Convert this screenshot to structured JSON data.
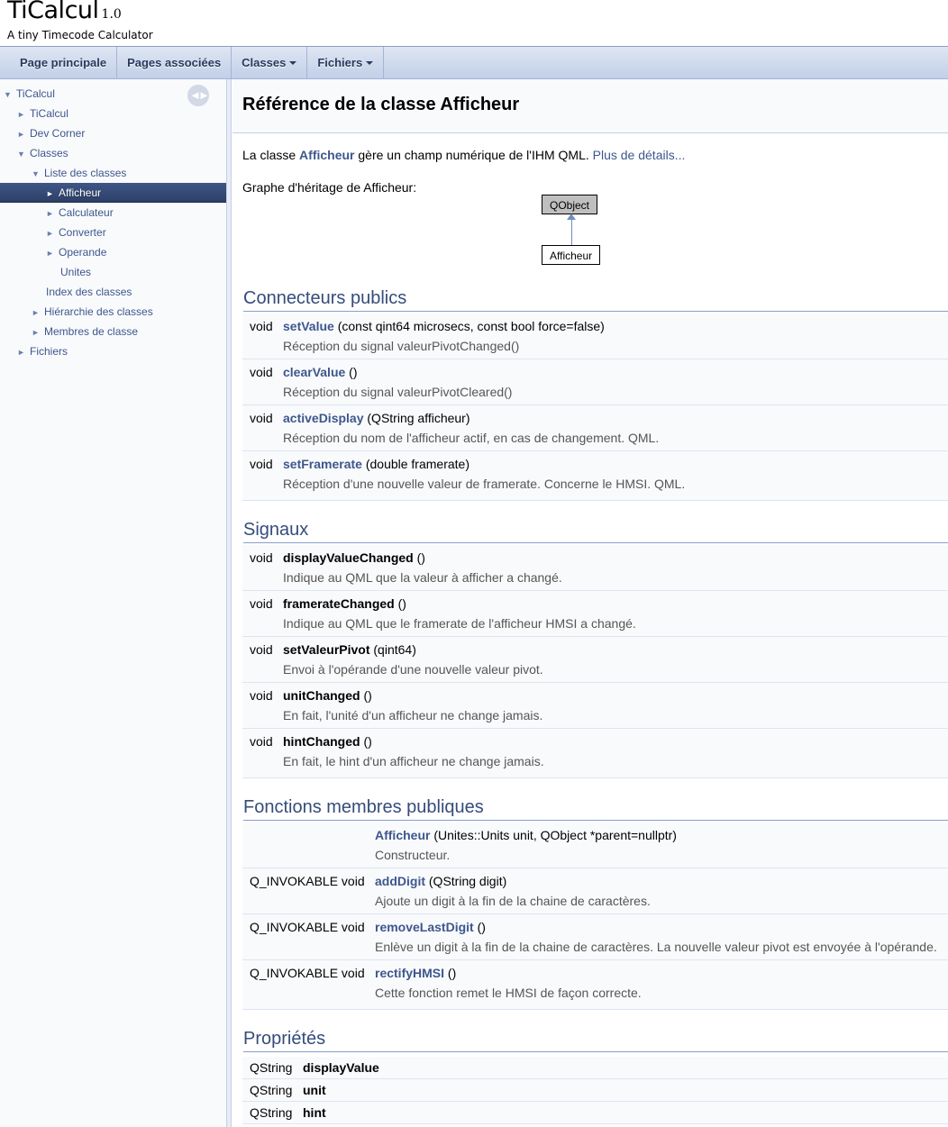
{
  "project": {
    "name": "TiCalcul",
    "number": "1.0",
    "brief": "A tiny Timecode Calculator"
  },
  "nav": {
    "main": "Page principale",
    "related": "Pages associées",
    "classes": "Classes",
    "files": "Fichiers"
  },
  "sidebar": {
    "sync_icon": "sync-arrows-icon",
    "items": [
      {
        "label": "TiCalcul",
        "arrow": "▼"
      },
      {
        "label": "TiCalcul",
        "arrow": "►"
      },
      {
        "label": "Dev Corner",
        "arrow": "►"
      },
      {
        "label": "Classes",
        "arrow": "▼"
      },
      {
        "label": "Liste des classes",
        "arrow": "▼"
      },
      {
        "label": "Afficheur",
        "arrow": "►"
      },
      {
        "label": "Calculateur",
        "arrow": "►"
      },
      {
        "label": "Converter",
        "arrow": "►"
      },
      {
        "label": "Operande",
        "arrow": "►"
      },
      {
        "label": "Unites",
        "arrow": ""
      },
      {
        "label": "Index des classes",
        "arrow": ""
      },
      {
        "label": "Hiérarchie des classes",
        "arrow": "►"
      },
      {
        "label": "Membres de classe",
        "arrow": "►"
      },
      {
        "label": "Fichiers",
        "arrow": "►"
      }
    ]
  },
  "page": {
    "title": "Référence de la classe Afficheur",
    "intro_pre": "La classe",
    "intro_class": "Afficheur",
    "intro_post": "gère un champ numérique de l'IHM QML.",
    "more_details": "Plus de détails...",
    "graph_label": "Graphe d'héritage de Afficheur:",
    "graph_parent": "QObject",
    "graph_child": "Afficheur"
  },
  "public_slots": {
    "header": "Connecteurs publics",
    "rows": [
      {
        "type": "void",
        "name": "setValue",
        "args": "(const qint64 microsecs, const bool force=false)",
        "desc": "Réception du signal valeurPivotChanged()"
      },
      {
        "type": "void",
        "name": "clearValue",
        "args": "()",
        "desc": "Réception du signal valeurPivotCleared()"
      },
      {
        "type": "void",
        "name": "activeDisplay",
        "args": "(QString afficheur)",
        "desc": "Réception du nom de l'afficheur actif, en cas de changement. QML."
      },
      {
        "type": "void",
        "name": "setFramerate",
        "args": "(double framerate)",
        "desc": "Réception d'une nouvelle valeur de framerate. Concerne le HMSI. QML."
      }
    ]
  },
  "signals": {
    "header": "Signaux",
    "rows": [
      {
        "type": "void",
        "name": "displayValueChanged",
        "args": "()",
        "desc": "Indique au QML que la valeur à afficher a changé."
      },
      {
        "type": "void",
        "name": "framerateChanged",
        "args": "()",
        "desc": "Indique au QML que le framerate de l'afficheur HMSI a changé."
      },
      {
        "type": "void",
        "name": "setValeurPivot",
        "args": "(qint64)",
        "desc": "Envoi à l'opérande d'une nouvelle valeur pivot."
      },
      {
        "type": "void",
        "name": "unitChanged",
        "args": "()",
        "desc": "En fait, l'unité d'un afficheur ne change jamais."
      },
      {
        "type": "void",
        "name": "hintChanged",
        "args": "()",
        "desc": "En fait, le hint d'un afficheur ne change jamais."
      }
    ]
  },
  "public_members": {
    "header": "Fonctions membres publiques",
    "rows": [
      {
        "type": "",
        "name": "Afficheur",
        "args": "(Unites::Units unit, QObject *parent=nullptr)",
        "desc": "Constructeur."
      },
      {
        "type": "Q_INVOKABLE void",
        "name": "addDigit",
        "args": "(QString digit)",
        "desc": "Ajoute un digit à la fin de la chaine de caractères."
      },
      {
        "type": "Q_INVOKABLE void",
        "name": "removeLastDigit",
        "args": "()",
        "desc": "Enlève un digit à la fin de la chaine de caractères. La nouvelle valeur pivot est envoyée à l'opérande."
      },
      {
        "type": "Q_INVOKABLE void",
        "name": "rectifyHMSI",
        "args": "()",
        "desc": "Cette fonction remet le HMSI de façon correcte."
      }
    ]
  },
  "properties": {
    "header": "Propriétés",
    "rows": [
      {
        "type": "QString",
        "name": "displayValue"
      },
      {
        "type": "QString",
        "name": "unit"
      },
      {
        "type": "QString",
        "name": "hint"
      }
    ]
  }
}
